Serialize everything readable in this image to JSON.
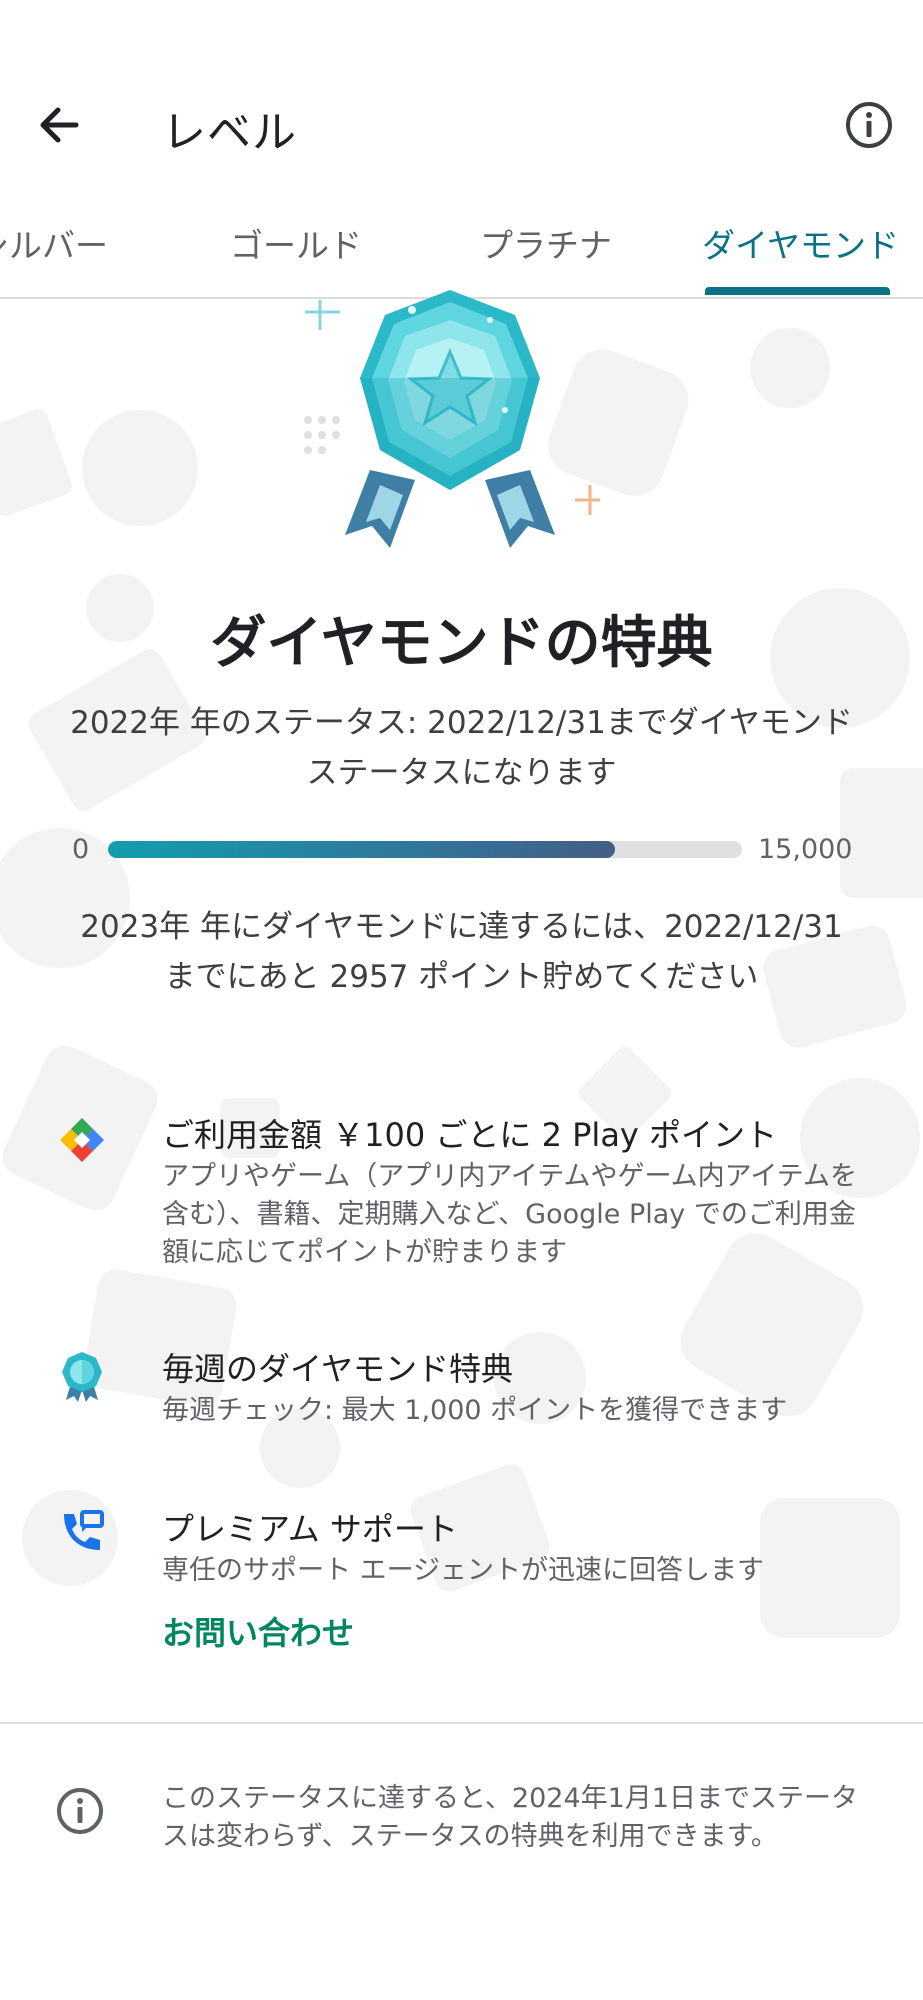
{
  "header": {
    "title": "レベル",
    "back_icon": "arrow-left-icon",
    "info_icon": "info-circle-icon"
  },
  "tabs": [
    {
      "label": "シルバー",
      "selected": false
    },
    {
      "label": "ゴールド",
      "selected": false
    },
    {
      "label": "プラチナ",
      "selected": false
    },
    {
      "label": "ダイヤモンド",
      "selected": true
    }
  ],
  "hero": {
    "medal_icon": "diamond-medal-icon",
    "heading": "ダイヤモンドの特典",
    "status_text": "2022年 年のステータス: 2022/12/31までダイヤモンド ステータスになります"
  },
  "progress": {
    "min_label": "0",
    "max_label": "15,000",
    "fraction": 0.8
  },
  "goal_text": "2023年 年にダイヤモンドに達するには、2022/12/31 までにあと 2957 ポイント貯めてください",
  "benefits": [
    {
      "icon": "play-points-icon",
      "title": "ご利用金額 ￥100 ごとに 2 Play ポイント",
      "description": "アプリやゲーム（アプリ内アイテムやゲーム内アイテムを含む）、書籍、定期購入など、Google Play でのご利用金額に応じてポイントが貯まります"
    },
    {
      "icon": "weekly-medal-icon",
      "title": "毎週のダイヤモンド特典",
      "description": "毎週チェック: 最大 1,000 ポイントを獲得できます"
    },
    {
      "icon": "support-phone-icon",
      "title": "プレミアム サポート",
      "description": "専任のサポート エージェントが迅速に回答します",
      "link_label": "お問い合わせ"
    }
  ],
  "footer": {
    "icon": "info-circle-icon",
    "text": "このステータスに達すると、2024年1月1日までステータスは変わらず、ステータスの特典を利用できます。"
  },
  "colors": {
    "accent": "#0b7285",
    "link": "#01875f",
    "progress_start": "#129eaf",
    "progress_end": "#445e86"
  }
}
